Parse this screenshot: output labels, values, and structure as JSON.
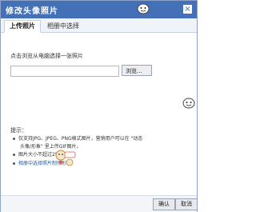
{
  "dialog": {
    "title": "修改头像照片",
    "close_label": "×"
  },
  "tabs": [
    {
      "label": "上传照片",
      "active": true
    },
    {
      "label": "相册中选择",
      "active": false
    }
  ],
  "upload": {
    "prompt": "点击浏览从电脑选择一张照片",
    "file_value": "",
    "browse_label": "浏览..."
  },
  "tips": {
    "title": "提示：",
    "items": [
      "仅支持JPG、JPEG、PNG格式图片，营销用户可以在 \"动态",
      "头像/形象\" 里上传GIF图片。",
      "图片大小不超过2M",
      "相册中选择照片制作形象"
    ],
    "link_text": "相册中选择"
  },
  "footer": {
    "ok_label": "确认",
    "cancel_label": "取消"
  },
  "colors": {
    "titlebar": "#4470b8",
    "link": "#1f5fa8"
  }
}
